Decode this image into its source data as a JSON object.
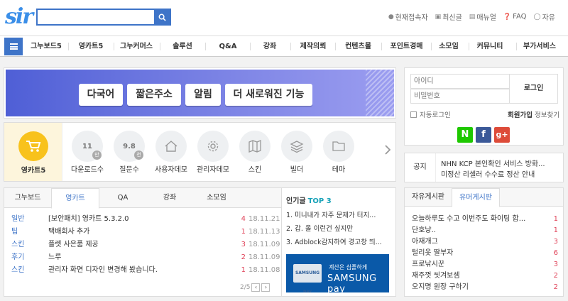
{
  "header": {
    "logo": "sir",
    "search": {
      "placeholder": "",
      "value": ""
    },
    "links": [
      {
        "icon": "user-icon",
        "label": "현재접속자"
      },
      {
        "icon": "document-icon",
        "label": "최신글"
      },
      {
        "icon": "book-icon",
        "label": "매뉴얼"
      },
      {
        "icon": "question-icon",
        "label": "FAQ"
      },
      {
        "icon": "chat-icon",
        "label": "자유"
      }
    ]
  },
  "nav": {
    "items": [
      "그누보드5",
      "영카트5",
      "그누커머스",
      "솔루션",
      "Q&A",
      "강좌",
      "제작의뢰",
      "컨텐츠몰",
      "포인트경매",
      "소모임",
      "커뮤니티",
      "부가서비스"
    ]
  },
  "banner": {
    "buttons": [
      "다국어",
      "짧은주소",
      "알림",
      "더 새로워진 기능"
    ]
  },
  "icon_row": {
    "featured": "영카트5",
    "items": [
      {
        "label": "다운로드수",
        "value": "11",
        "badge": "만"
      },
      {
        "label": "질문수",
        "value": "9.8",
        "badge": "천"
      },
      {
        "label": "사용자데모",
        "icon": "home-icon"
      },
      {
        "label": "관리자데모",
        "icon": "gear-icon"
      },
      {
        "label": "스킨",
        "icon": "map-icon"
      },
      {
        "label": "빌더",
        "icon": "layers-icon"
      },
      {
        "label": "테마",
        "icon": "folder-icon"
      }
    ]
  },
  "board": {
    "tabs": [
      "그누보드",
      "영카트",
      "QA",
      "강좌",
      "소모임"
    ],
    "active_tab": "영카트",
    "rows": [
      {
        "category": "일반",
        "title": "[보안패치] 영카트 5.3.2.0",
        "count": "4",
        "date": "18.11.21"
      },
      {
        "category": "팁",
        "title": "택배회사 추가",
        "count": "1",
        "date": "18.11.13"
      },
      {
        "category": "스킨",
        "title": "플렛 사은품 제공",
        "count": "3",
        "date": "18.11.09"
      },
      {
        "category": "후기",
        "title": "느루",
        "count": "2",
        "date": "18.11.09"
      },
      {
        "category": "스킨",
        "title": "관리자 화면 디자인 변경해 봤습니다.",
        "count": "1",
        "date": "18.11.08"
      }
    ],
    "pager": "2/5"
  },
  "popular": {
    "title": "인기글",
    "badge": "TOP 3",
    "items": [
      "1. 미니내가 자주 문제가 터지...",
      "2. 갑. 올 이런건 싶지만",
      "3. Adblock감지하여 경고창 띄..."
    ]
  },
  "ad": {
    "phone_label": "SAMSUNG pay",
    "subtitle": "계산은 심플하게",
    "brand": "SAMSUNG pay"
  },
  "login": {
    "id_placeholder": "아이디",
    "pw_placeholder": "비밀번호",
    "login_button": "로그인",
    "auto_login": "자동로그인",
    "join": "회원가입",
    "find_info": "정보찾기",
    "social": [
      {
        "name": "naver",
        "label": "N",
        "color": "#1ec800"
      },
      {
        "name": "facebook",
        "label": "f",
        "color": "#3b5998"
      },
      {
        "name": "google",
        "label": "g+",
        "color": "#dd4b39"
      }
    ]
  },
  "notice": {
    "label": "공지",
    "items": [
      "NHN KCP 본인확인 서비스 방화...",
      "미정산 리셀러 수수료 정산 안내"
    ]
  },
  "free_board": {
    "tabs": [
      "자유게시판",
      "유머게시판"
    ],
    "active_tab": "유머게시판",
    "rows": [
      {
        "title": "오늘하루도 수고 이번주도 화이팅 합...",
        "count": "1"
      },
      {
        "title": "단호냥..",
        "count": "1"
      },
      {
        "title": "아재개그",
        "count": "3"
      },
      {
        "title": "털리옷 딸부자",
        "count": "6"
      },
      {
        "title": "프로낚시꾼",
        "count": "3"
      },
      {
        "title": "재주껏 씻겨보셈",
        "count": "2"
      },
      {
        "title": "오지명 원장 구하기",
        "count": "2"
      }
    ]
  },
  "colors": {
    "accent": "#3e74c8",
    "count_red": "#e0455b",
    "yellow": "#f8c21c"
  }
}
